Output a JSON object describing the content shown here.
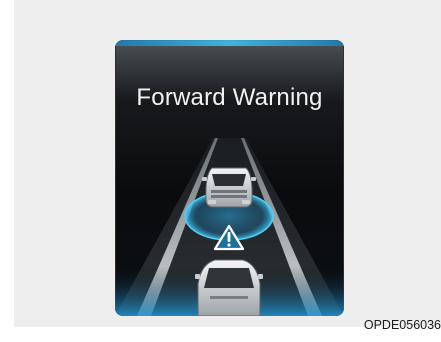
{
  "screen": {
    "title": "Forward Warning",
    "warning_icon": "warning-triangle-icon",
    "accent_color": "#3fc4f0"
  },
  "figure_code": "OPDE056036"
}
